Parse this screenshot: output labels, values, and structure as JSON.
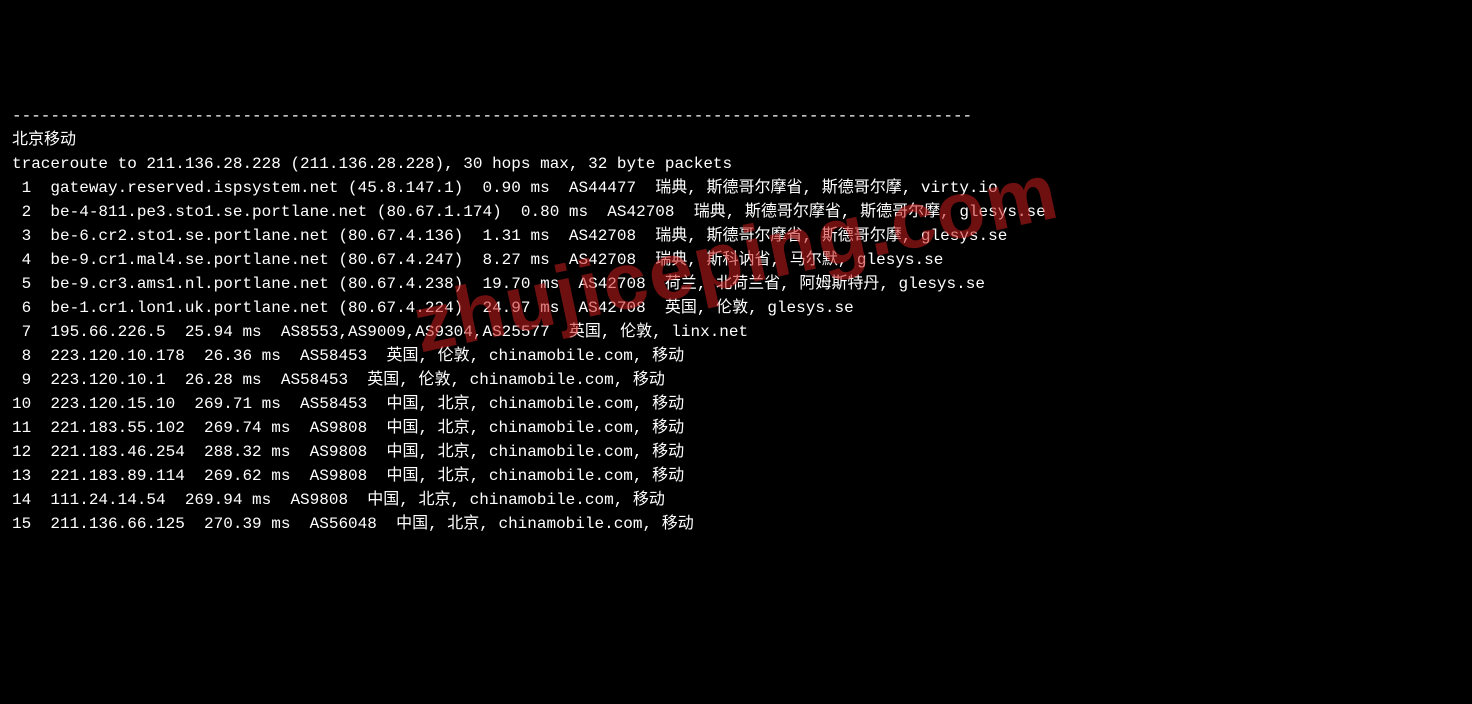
{
  "separator": "----------------------------------------------------------------------------------------------------",
  "title": "北京移动",
  "header": "traceroute to 211.136.28.228 (211.136.28.228), 30 hops max, 32 byte packets",
  "watermark": "zhujiceping.com",
  "hops": [
    {
      "n": " 1",
      "text": "gateway.reserved.ispsystem.net (45.8.147.1)  0.90 ms  AS44477  瑞典, 斯德哥尔摩省, 斯德哥尔摩, virty.io"
    },
    {
      "n": " 2",
      "text": "be-4-811.pe3.sto1.se.portlane.net (80.67.1.174)  0.80 ms  AS42708  瑞典, 斯德哥尔摩省, 斯德哥尔摩, glesys.se"
    },
    {
      "n": " 3",
      "text": "be-6.cr2.sto1.se.portlane.net (80.67.4.136)  1.31 ms  AS42708  瑞典, 斯德哥尔摩省, 斯德哥尔摩, glesys.se"
    },
    {
      "n": " 4",
      "text": "be-9.cr1.mal4.se.portlane.net (80.67.4.247)  8.27 ms  AS42708  瑞典, 斯科讷省, 马尔默, glesys.se"
    },
    {
      "n": " 5",
      "text": "be-9.cr3.ams1.nl.portlane.net (80.67.4.238)  19.70 ms  AS42708  荷兰, 北荷兰省, 阿姆斯特丹, glesys.se"
    },
    {
      "n": " 6",
      "text": "be-1.cr1.lon1.uk.portlane.net (80.67.4.224)  24.97 ms  AS42708  英国, 伦敦, glesys.se"
    },
    {
      "n": " 7",
      "text": "195.66.226.5  25.94 ms  AS8553,AS9009,AS9304,AS25577  英国, 伦敦, linx.net"
    },
    {
      "n": " 8",
      "text": "223.120.10.178  26.36 ms  AS58453  英国, 伦敦, chinamobile.com, 移动"
    },
    {
      "n": " 9",
      "text": "223.120.10.1  26.28 ms  AS58453  英国, 伦敦, chinamobile.com, 移动"
    },
    {
      "n": "10",
      "text": "223.120.15.10  269.71 ms  AS58453  中国, 北京, chinamobile.com, 移动"
    },
    {
      "n": "11",
      "text": "221.183.55.102  269.74 ms  AS9808  中国, 北京, chinamobile.com, 移动"
    },
    {
      "n": "12",
      "text": "221.183.46.254  288.32 ms  AS9808  中国, 北京, chinamobile.com, 移动"
    },
    {
      "n": "13",
      "text": "221.183.89.114  269.62 ms  AS9808  中国, 北京, chinamobile.com, 移动"
    },
    {
      "n": "14",
      "text": "111.24.14.54  269.94 ms  AS9808  中国, 北京, chinamobile.com, 移动"
    },
    {
      "n": "15",
      "text": "211.136.66.125  270.39 ms  AS56048  中国, 北京, chinamobile.com, 移动"
    }
  ]
}
